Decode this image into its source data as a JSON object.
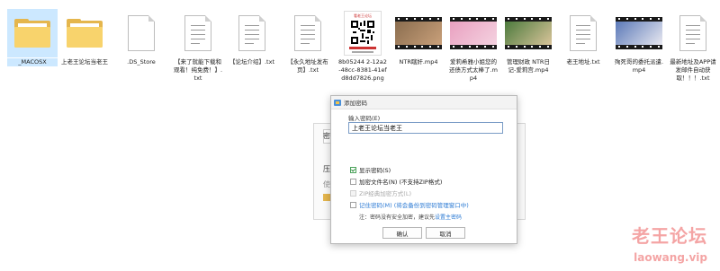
{
  "files": [
    {
      "name": "_MACOSX",
      "type": "folder",
      "selected": true
    },
    {
      "name": "上老王论坛当老王",
      "type": "folder"
    },
    {
      "name": ".DS_Store",
      "type": "blank"
    },
    {
      "name": "【来了就能下载和观看！纯免费！】.txt",
      "type": "txt"
    },
    {
      "name": "【论坛介绍】.txt",
      "type": "txt"
    },
    {
      "name": "【永久地址发布页】.txt",
      "type": "txt"
    },
    {
      "name": "8b05244 2-12a2-48cc-8381-41efd8dd7826.png",
      "type": "png",
      "qr_header": "看老王论坛"
    },
    {
      "name": "NTR瞎奸.mp4",
      "type": "video",
      "colors": [
        "#8a6d4f",
        "#c9a07a"
      ]
    },
    {
      "name": "爱莉希雅小姐您的还债方式太棒了.mp4",
      "type": "video",
      "colors": [
        "#e9a0c0",
        "#f4d2e0"
      ]
    },
    {
      "name": "管理财政 NTR日记-爱莉宫.mp4",
      "type": "video",
      "colors": [
        "#4c7a3d",
        "#d9c49a"
      ]
    },
    {
      "name": "老王地址.txt",
      "type": "txt"
    },
    {
      "name": "殉死哥的委托派遣.mp4",
      "type": "video",
      "colors": [
        "#5b79b8",
        "#e8e8f0"
      ]
    },
    {
      "name": "最新地址及APP请发邮件自动获取！！！.txt",
      "type": "txt"
    }
  ],
  "back_dialog": {
    "letters": [
      "密",
      "压",
      "使"
    ]
  },
  "dialog": {
    "title": "添加密码",
    "password_label": "输入密码(E)",
    "password_value": "上老王论坛当老王",
    "options": [
      {
        "label": "显示密码(S)",
        "checked": true,
        "state": "normal"
      },
      {
        "label": "加密文件名(N) (不支持ZIP格式)",
        "checked": false,
        "state": "normal"
      },
      {
        "label": "ZIP经典加密方式(L)",
        "checked": false,
        "state": "disabled"
      },
      {
        "label": "记住密码(M) (将会备份到密码管理窗口中)",
        "checked": false,
        "state": "blue"
      }
    ],
    "note_prefix": "注：密码没有安全加密，建议先",
    "note_link": "设置主密码",
    "ok_label": "确认",
    "cancel_label": "取消"
  },
  "watermark": {
    "line1": "老王论坛",
    "line2": "laowang.vip"
  }
}
